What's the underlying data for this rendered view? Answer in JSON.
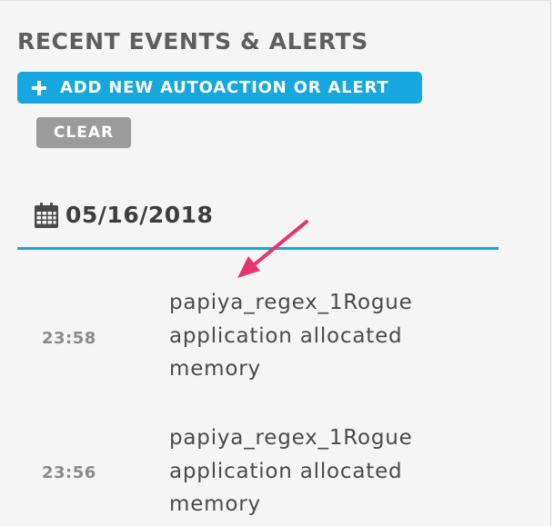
{
  "panel": {
    "title": "RECENT EVENTS & ALERTS",
    "add_button_label": "ADD NEW AUTOACTION OR ALERT",
    "clear_button_label": "CLEAR"
  },
  "date_group": {
    "date": "05/16/2018",
    "icon": "calendar-icon"
  },
  "events": [
    {
      "time": "23:58",
      "message_lines": [
        "papiya_regex_1Rogue",
        "application allocated",
        "memory"
      ]
    },
    {
      "time": "23:56",
      "message_lines": [
        "papiya_regex_1Rogue",
        "application allocated",
        "memory"
      ]
    }
  ],
  "colors": {
    "accent": "#15a7dd",
    "clear_button": "#9b9b9b",
    "annotation_arrow": "#e8336d",
    "panel_background": "#f5f5f5"
  }
}
